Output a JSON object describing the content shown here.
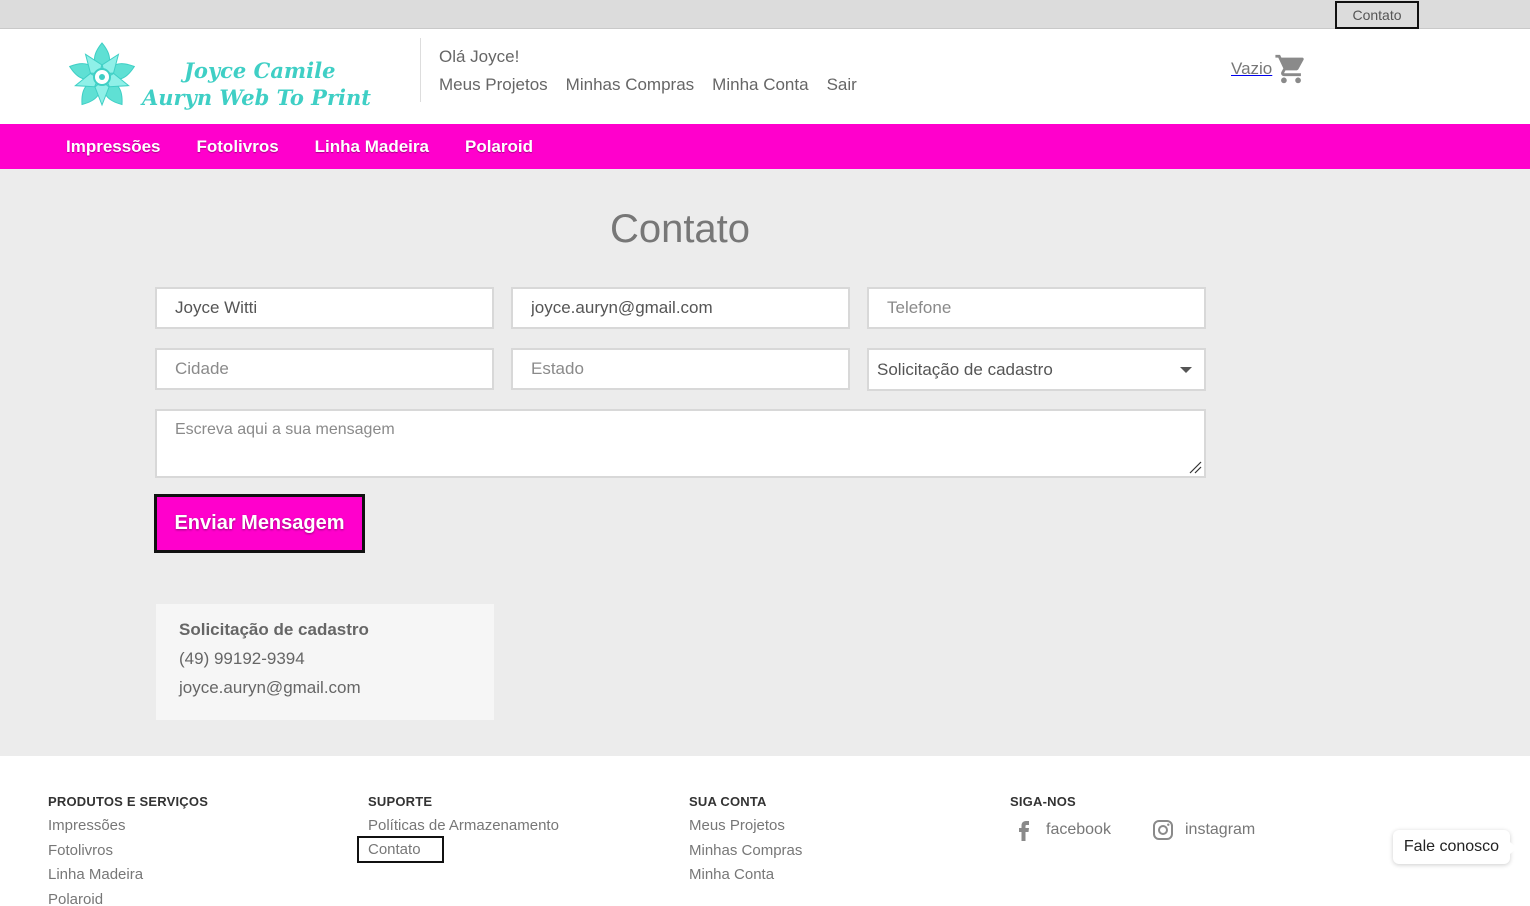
{
  "topbar": {
    "contact_link": "Contato"
  },
  "logo": {
    "line1": "Joyce Camile",
    "line2": "Auryn Web To Print"
  },
  "header": {
    "greeting": "Olá Joyce!",
    "user_nav": [
      "Meus Projetos",
      "Minhas Compras",
      "Minha Conta",
      "Sair"
    ],
    "cart_label": "Vazio"
  },
  "main_nav": [
    "Impressões",
    "Fotolivros",
    "Linha Madeira",
    "Polaroid"
  ],
  "page": {
    "title": "Contato"
  },
  "form": {
    "name_value": "Joyce Witti",
    "email_value": "joyce.auryn@gmail.com",
    "phone_placeholder": "Telefone",
    "city_placeholder": "Cidade",
    "state_placeholder": "Estado",
    "subject_selected": "Solicitação de cadastro",
    "message_placeholder": "Escreva aqui a sua mensagem",
    "submit_label": "Enviar Mensagem"
  },
  "info_box": {
    "title": "Solicitação de cadastro",
    "phone": "(49) 99192-9394",
    "email": "joyce.auryn@gmail.com"
  },
  "footer": {
    "products": {
      "heading": "PRODUTOS E SERVIÇOS",
      "links": [
        "Impressões",
        "Fotolivros",
        "Linha Madeira",
        "Polaroid"
      ]
    },
    "support": {
      "heading": "SUPORTE",
      "links": [
        "Políticas de Armazenamento",
        "Contato"
      ]
    },
    "account": {
      "heading": "SUA CONTA",
      "links": [
        "Meus Projetos",
        "Minhas Compras",
        "Minha Conta"
      ]
    },
    "social": {
      "heading": "SIGA-NOS",
      "facebook": "facebook",
      "instagram": "instagram"
    }
  },
  "chat": {
    "label": "Fale conosco"
  },
  "colors": {
    "brand_magenta": "#ff00cc",
    "logo_teal": "#3fcfc5",
    "content_bg": "#ececec"
  },
  "icons": [
    "logo-flower-icon",
    "cart-icon",
    "chevron-down-icon",
    "facebook-icon",
    "instagram-icon",
    "resize-grip-icon"
  ]
}
